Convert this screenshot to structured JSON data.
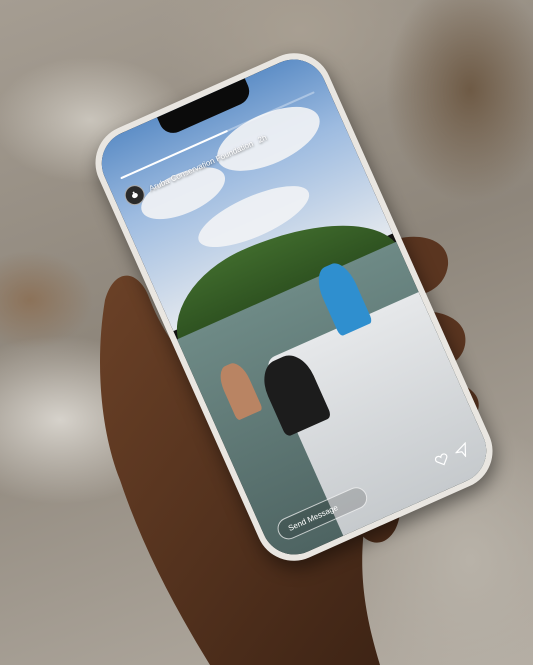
{
  "story": {
    "account_name": "Aruba Conservation Foundation",
    "time_ago": "2h",
    "progress": 0.55,
    "send_message_placeholder": "Send Message"
  },
  "icons": {
    "avatar": "turtle-logo-icon",
    "share": "paper-plane-icon",
    "like": "heart-icon"
  }
}
